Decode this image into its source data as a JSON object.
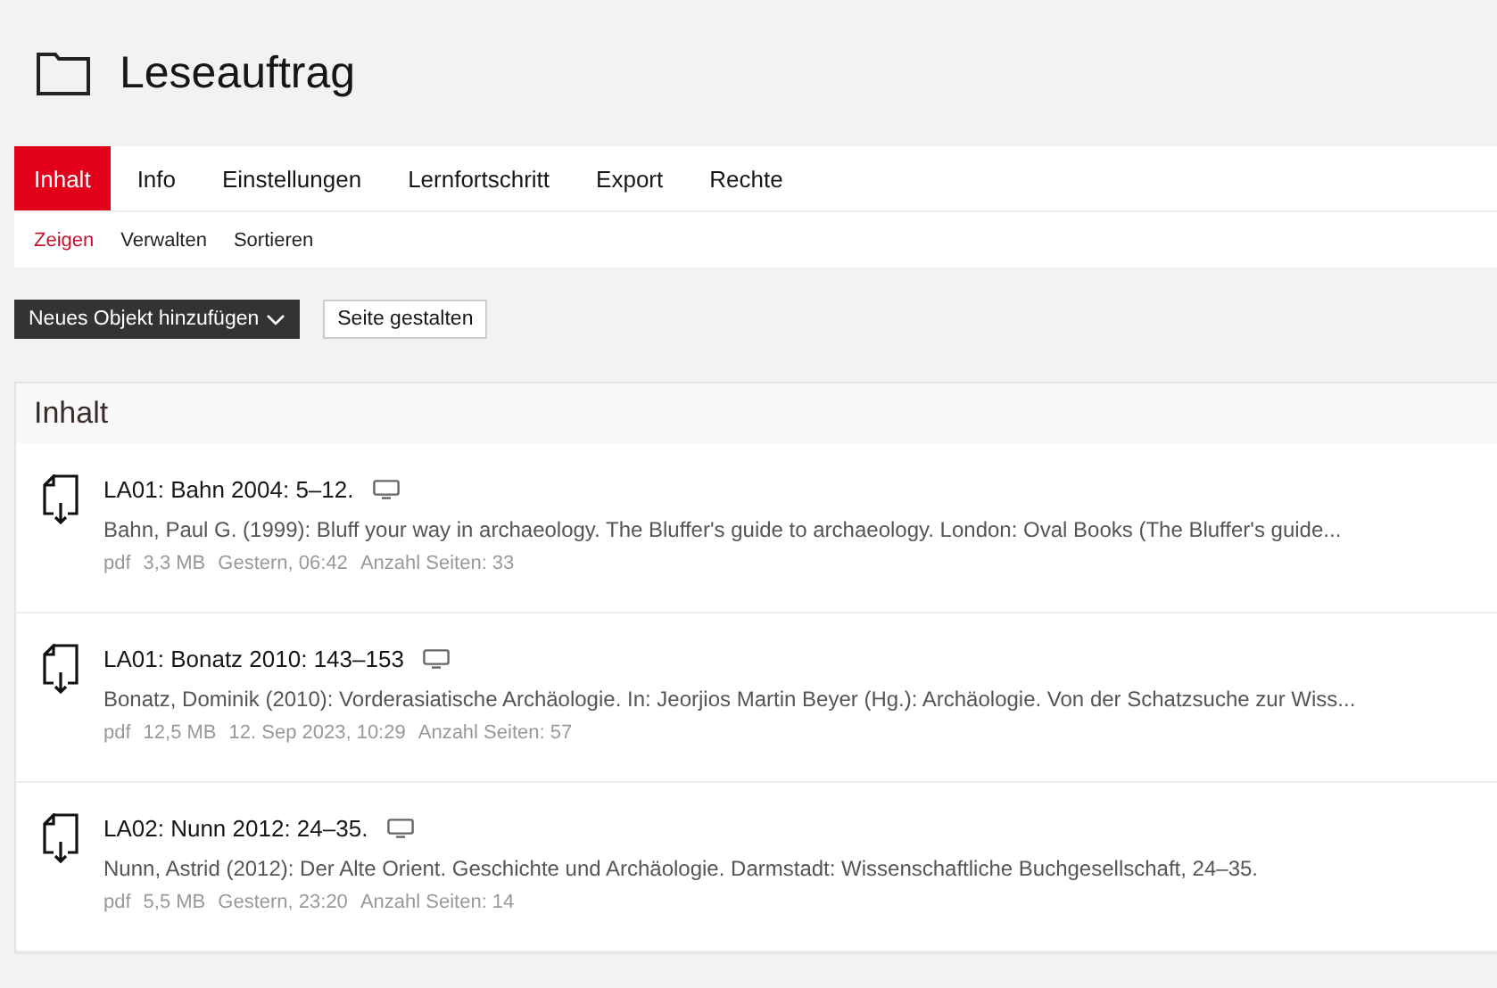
{
  "page": {
    "title": "Leseauftrag"
  },
  "tabs": [
    {
      "label": "Inhalt",
      "selected": true
    },
    {
      "label": "Info",
      "selected": false
    },
    {
      "label": "Einstellungen",
      "selected": false
    },
    {
      "label": "Lernfortschritt",
      "selected": false
    },
    {
      "label": "Export",
      "selected": false
    },
    {
      "label": "Rechte",
      "selected": false
    }
  ],
  "subtabs": [
    {
      "label": "Zeigen",
      "selected": true
    },
    {
      "label": "Verwalten",
      "selected": false
    },
    {
      "label": "Sortieren",
      "selected": false
    }
  ],
  "toolbar": {
    "add_button": "Neues Objekt hinzufügen",
    "layout_button": "Seite gestalten"
  },
  "panel": {
    "title": "Inhalt",
    "items": [
      {
        "title": "LA01: Bahn 2004: 5–12.",
        "description": "Bahn, Paul G. (1999): Bluff your way in archaeology. The Bluffer's guide to archaeology. London: Oval Books (The Bluffer's guide...",
        "meta": [
          "pdf",
          "3,3 MB",
          "Gestern, 06:42",
          "Anzahl Seiten: 33"
        ]
      },
      {
        "title": "LA01: Bonatz 2010: 143–153",
        "description": "Bonatz, Dominik (2010): Vorderasiatische Archäologie. In: Jeorjios Martin Beyer (Hg.): Archäologie. Von der Schatzsuche zur Wiss...",
        "meta": [
          "pdf",
          "12,5 MB",
          "12. Sep 2023, 10:29",
          "Anzahl Seiten: 57"
        ]
      },
      {
        "title": "LA02: Nunn 2012: 24–35.",
        "description": "Nunn, Astrid (2012): Der Alte Orient. Geschichte und Archäologie. Darmstadt: Wissenschaftliche Buchgesellschaft, 24–35.",
        "meta": [
          "pdf",
          "5,5 MB",
          "Gestern, 23:20",
          "Anzahl Seiten: 14"
        ]
      }
    ]
  }
}
